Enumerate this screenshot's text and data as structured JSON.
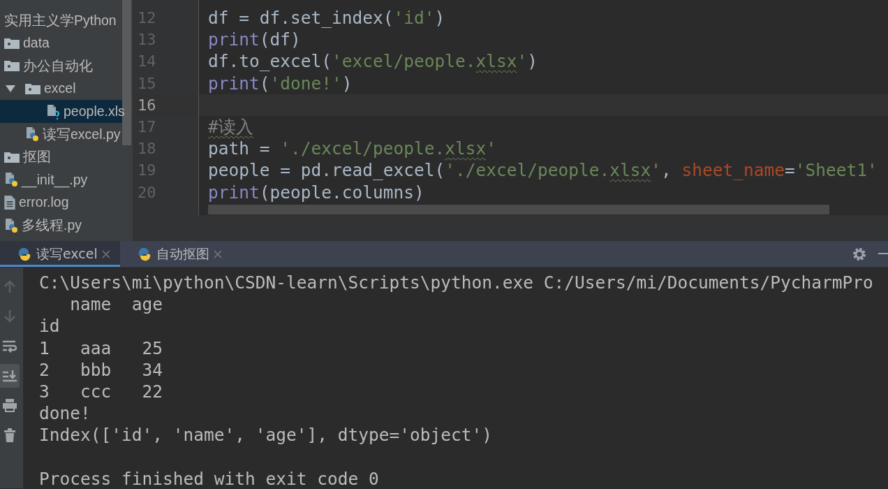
{
  "project_tree": [
    {
      "label": "实用主义学Python",
      "kind": "label",
      "selected": false
    },
    {
      "label": "data",
      "kind": "folder",
      "selected": false
    },
    {
      "label": "办公自动化",
      "kind": "folder",
      "selected": false,
      "children": [
        {
          "label": "excel",
          "kind": "folder",
          "selected": false,
          "expanded": true,
          "children": [
            {
              "label": "people.xls",
              "kind": "unknown-file",
              "selected": true
            }
          ]
        },
        {
          "label": "读写excel.py",
          "kind": "python-file",
          "selected": false
        }
      ]
    },
    {
      "label": "抠图",
      "kind": "folder",
      "selected": false
    },
    {
      "label": "__init__.py",
      "kind": "python-file",
      "selected": false
    },
    {
      "label": "error.log",
      "kind": "text-file",
      "selected": false
    },
    {
      "label": "多线程.py",
      "kind": "python-file",
      "selected": false
    }
  ],
  "editor": {
    "lines": [
      {
        "number": "12",
        "current": false,
        "tokens": [
          {
            "kind": "plain",
            "text": "df = df.set_index("
          },
          {
            "kind": "string",
            "text": "'id'"
          },
          {
            "kind": "plain",
            "text": ")"
          }
        ]
      },
      {
        "number": "13",
        "current": false,
        "tokens": [
          {
            "kind": "builtin",
            "text": "print"
          },
          {
            "kind": "plain",
            "text": "(df)"
          }
        ]
      },
      {
        "number": "14",
        "current": false,
        "tokens": [
          {
            "kind": "plain",
            "text": "df.to_excel("
          },
          {
            "kind": "string",
            "text": "'excel/people."
          },
          {
            "kind": "string",
            "text": "xlsx",
            "typo": true
          },
          {
            "kind": "string",
            "text": "'"
          },
          {
            "kind": "plain",
            "text": ")"
          }
        ]
      },
      {
        "number": "15",
        "current": false,
        "tokens": [
          {
            "kind": "builtin",
            "text": "print"
          },
          {
            "kind": "plain",
            "text": "("
          },
          {
            "kind": "string",
            "text": "'done!'"
          },
          {
            "kind": "plain",
            "text": ")"
          }
        ]
      },
      {
        "number": "16",
        "current": true
      },
      {
        "number": "17",
        "current": false,
        "tokens": [
          {
            "kind": "comment",
            "text": "#读入",
            "typo": true
          }
        ]
      },
      {
        "number": "18",
        "current": false,
        "tokens": [
          {
            "kind": "plain",
            "text": "path = "
          },
          {
            "kind": "string",
            "text": "'./excel/people."
          },
          {
            "kind": "string",
            "text": "xlsx",
            "typo": true
          },
          {
            "kind": "string",
            "text": "'"
          }
        ]
      },
      {
        "number": "19",
        "current": false,
        "tokens": [
          {
            "kind": "plain",
            "text": "people = pd.read_excel("
          },
          {
            "kind": "string",
            "text": "'./excel/people."
          },
          {
            "kind": "string",
            "text": "xlsx",
            "typo": true
          },
          {
            "kind": "string",
            "text": "'"
          },
          {
            "kind": "plain",
            "text": ", "
          },
          {
            "kind": "param",
            "text": "sheet_name"
          },
          {
            "kind": "plain",
            "text": "="
          },
          {
            "kind": "string",
            "text": "'Sheet1'"
          }
        ]
      },
      {
        "number": "20",
        "current": false,
        "tokens": [
          {
            "kind": "builtin",
            "text": "print"
          },
          {
            "kind": "plain",
            "text": "(people.columns)"
          }
        ]
      }
    ]
  },
  "run_tabs": [
    {
      "label": "读写excel",
      "selected": true
    },
    {
      "label": "自动抠图",
      "selected": false
    }
  ],
  "console_tools": [
    {
      "kind": "up",
      "selected": false
    },
    {
      "kind": "down",
      "selected": false
    },
    {
      "kind": "wrap",
      "selected": false
    },
    {
      "kind": "scroll-end",
      "selected": true
    },
    {
      "kind": "print",
      "selected": false
    },
    {
      "kind": "trash",
      "selected": false
    }
  ],
  "console": [
    {
      "text": "C:\\Users\\mi\\python\\CSDN-learn\\Scripts\\python.exe C:/Users/mi/Documents/PycharmPro"
    },
    {
      "text": "   name  age"
    },
    {
      "text": "id"
    },
    {
      "text": "1   aaa   25"
    },
    {
      "text": "2   bbb   34"
    },
    {
      "text": "3   ccc   22"
    },
    {
      "text": "done!"
    },
    {
      "text": "Index(['id', 'name', 'age'], dtype='object')"
    },
    {
      "text": "Process finished with exit code 0",
      "blank_before": true
    }
  ]
}
